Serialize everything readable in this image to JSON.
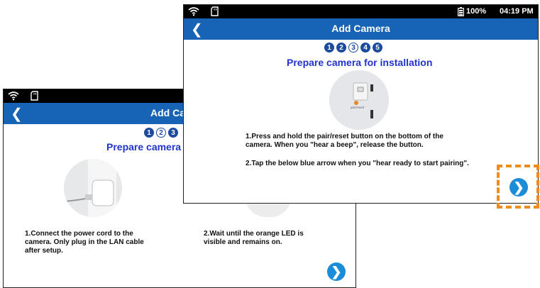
{
  "back_screen": {
    "title": "Add Camera",
    "steps": [
      "1",
      "2",
      "3"
    ],
    "subtitle": "Prepare camera for installation",
    "instruction_1": "1.Connect the power cord to the camera. Only plug in the LAN cable after setup.",
    "instruction_2": "2.Wait until the orange LED is visible and remains on."
  },
  "front_screen": {
    "status": {
      "battery": "100%",
      "time": "04:19 PM"
    },
    "title": "Add Camera",
    "steps": [
      "1",
      "2",
      "3",
      "4",
      "5"
    ],
    "current_step": 3,
    "subtitle": "Prepare camera for installation",
    "instruction_1": "1.Press and hold the pair/reset button on the bottom of the camera. When you \"hear a beep\", release the button.",
    "instruction_2": "2.Tap the below blue arrow when you \"hear ready to start pairing\"."
  },
  "colors": {
    "titlebar": "#1763b5",
    "subtitle": "#2233cc",
    "next_button": "#1a8cd8",
    "highlight": "#f08a1c"
  },
  "icons": [
    "wifi-icon",
    "sd-card-icon",
    "battery-icon",
    "back-icon",
    "next-arrow-icon"
  ]
}
